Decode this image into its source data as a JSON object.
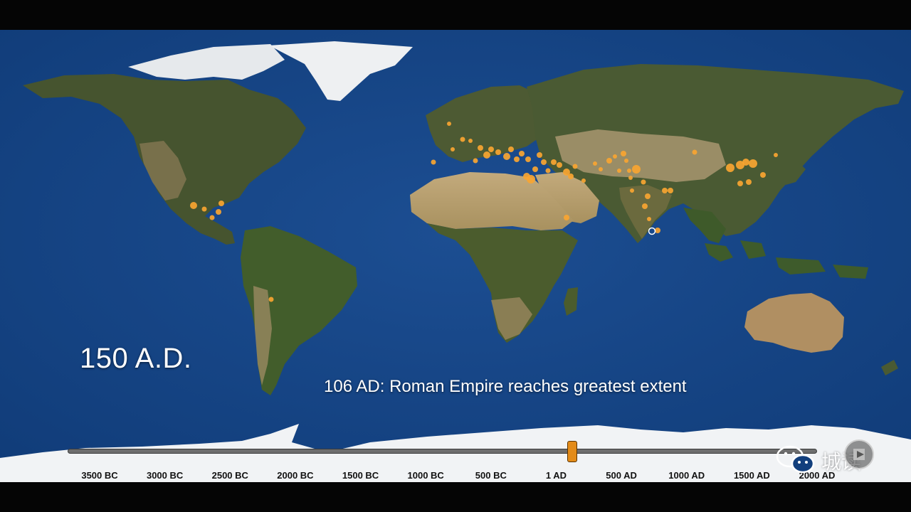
{
  "year_label": "150 A.D.",
  "event_caption": "106 AD: Roman Empire reaches greatest extent",
  "timeline": {
    "ticks": [
      "3500 BC",
      "3000 BC",
      "2500 BC",
      "2000 BC",
      "1500 BC",
      "1000 BC",
      "500 BC",
      "1 AD",
      "500 AD",
      "1000 AD",
      "1500 AD",
      "2000 AD"
    ],
    "handle_position_fraction": 0.672
  },
  "watermark": {
    "text": "城读",
    "icon": "wechat-bubbles-icon"
  },
  "colors": {
    "ocean": "#123f7d",
    "city_dot": "#f9a531",
    "handle": "#e38b19",
    "ice": "#f2f4f6",
    "land_green": "#4b5b32",
    "land_desert": "#b79e73"
  }
}
